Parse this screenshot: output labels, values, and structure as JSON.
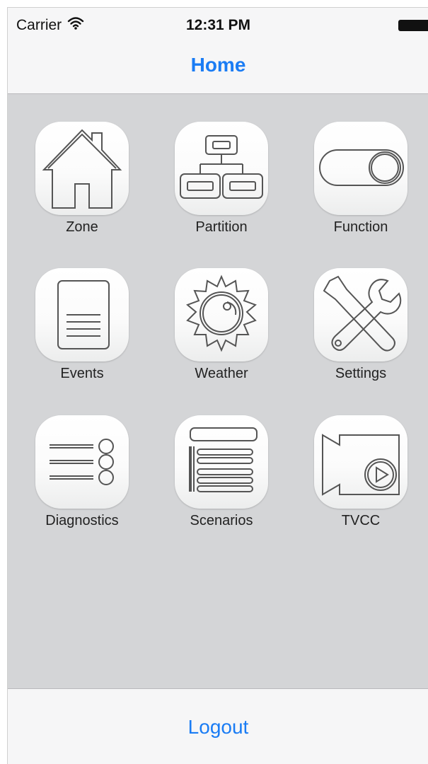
{
  "status_bar": {
    "carrier": "Carrier",
    "time": "12:31 PM",
    "wifi_icon": "wifi-icon",
    "battery_icon": "battery-icon"
  },
  "nav": {
    "title": "Home"
  },
  "tiles": [
    {
      "label": "Zone",
      "icon": "house-icon"
    },
    {
      "label": "Partition",
      "icon": "partition-tree-icon"
    },
    {
      "label": "Function",
      "icon": "toggle-switch-icon"
    },
    {
      "label": "Events",
      "icon": "document-list-icon"
    },
    {
      "label": "Weather",
      "icon": "sun-icon"
    },
    {
      "label": "Settings",
      "icon": "wrench-screwdriver-icon"
    },
    {
      "label": "Diagnostics",
      "icon": "diagnostics-list-icon"
    },
    {
      "label": "Scenarios",
      "icon": "scenarios-list-icon"
    },
    {
      "label": "TVCC",
      "icon": "video-camera-icon"
    }
  ],
  "footer": {
    "logout_label": "Logout"
  },
  "colors": {
    "accent": "#1a7cf4",
    "background": "#d4d5d7",
    "bar": "#f6f6f7",
    "icon_stroke": "#555555"
  }
}
